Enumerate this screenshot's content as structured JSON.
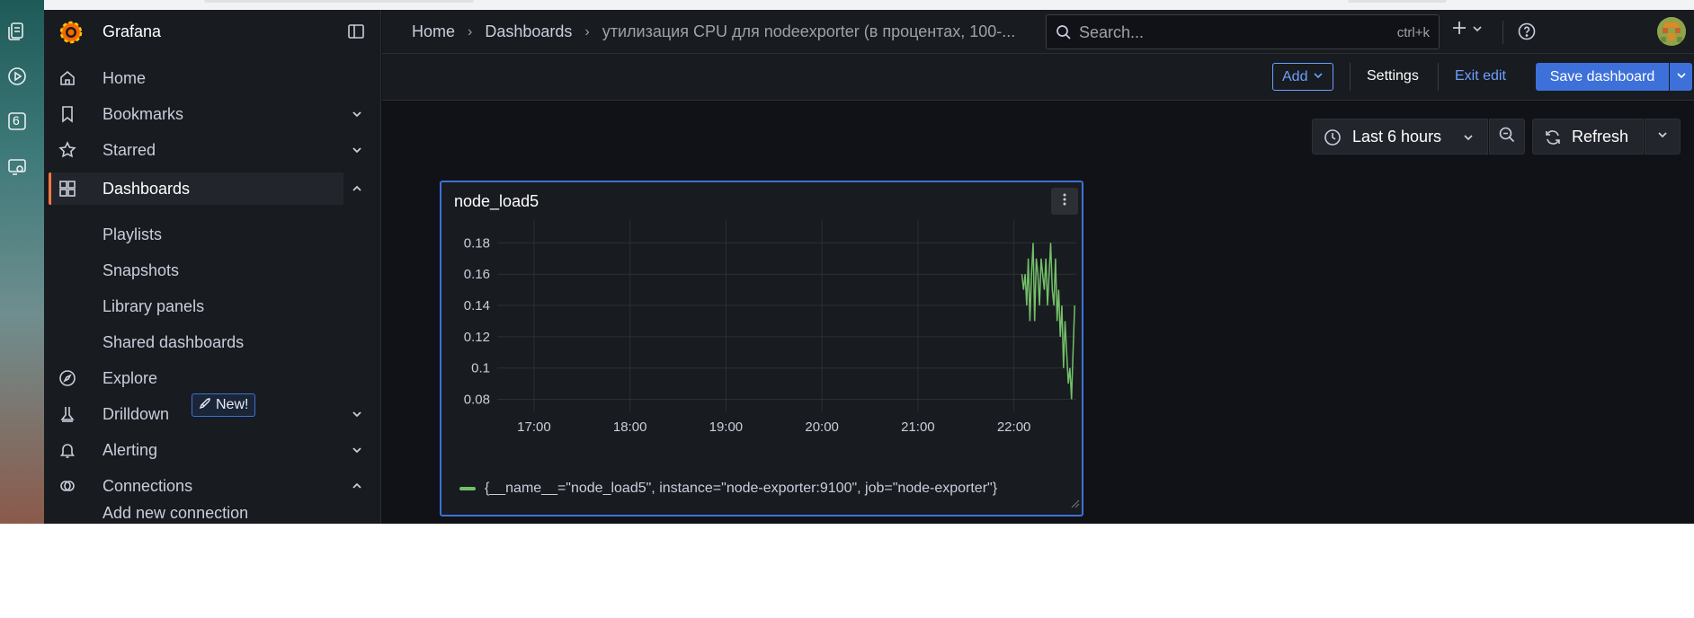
{
  "os_dock": {
    "icons": [
      "documents-icon",
      "play-icon",
      "number-badge-icon",
      "screenshot-icon"
    ],
    "badge_number": "6"
  },
  "brand": {
    "name": "Grafana"
  },
  "sidebar": {
    "items": [
      {
        "label": "Home",
        "icon": "home-icon"
      },
      {
        "label": "Bookmarks",
        "icon": "bookmark-icon",
        "expandable": true
      },
      {
        "label": "Starred",
        "icon": "star-icon",
        "expandable": true
      },
      {
        "label": "Dashboards",
        "icon": "dashboards-icon",
        "expanded": true,
        "active": true
      },
      {
        "label": "Explore",
        "icon": "compass-icon"
      },
      {
        "label": "Drilldown",
        "icon": "drilldown-icon",
        "expandable": true,
        "badge": "New!"
      },
      {
        "label": "Alerting",
        "icon": "bell-icon",
        "expandable": true
      },
      {
        "label": "Connections",
        "icon": "connections-icon",
        "expanded": true
      }
    ],
    "dashboards_children": [
      "Playlists",
      "Snapshots",
      "Library panels",
      "Shared dashboards"
    ],
    "connections_children": [
      "Add new connection"
    ]
  },
  "header": {
    "breadcrumbs": [
      "Home",
      "Dashboards",
      "утилизация CPU для nodeexporter (в процентах, 100-..."
    ],
    "search_placeholder": "Search...",
    "search_shortcut": "ctrl+k"
  },
  "edit_toolbar": {
    "add_label": "Add",
    "settings_label": "Settings",
    "exit_label": "Exit edit",
    "save_label": "Save dashboard"
  },
  "time_controls": {
    "range_label": "Last 6 hours",
    "refresh_label": "Refresh"
  },
  "panel": {
    "title": "node_load5",
    "legend": "{__name__=\"node_load5\", instance=\"node-exporter:9100\", job=\"node-exporter\"}",
    "series_color": "#73bf69"
  },
  "chart_data": {
    "type": "line",
    "title": "node_load5",
    "xlabel": "",
    "ylabel": "",
    "x_ticks": [
      "17:00",
      "18:00",
      "19:00",
      "20:00",
      "21:00",
      "22:00"
    ],
    "y_ticks": [
      0.18,
      0.16,
      0.14,
      0.12,
      0.1,
      0.08
    ],
    "y_tick_labels": [
      "0.18",
      "0.16",
      "0.14",
      "0.12",
      "0.1",
      "0.08"
    ],
    "ylim": [
      0.078,
      0.19
    ],
    "xlim": [
      "16:37",
      "22:39"
    ],
    "grid": true,
    "legend_position": "bottom-left",
    "series": [
      {
        "name": "{__name__=\"node_load5\", instance=\"node-exporter:9100\", job=\"node-exporter\"}",
        "color": "#73bf69",
        "x": [
          "22:05",
          "22:06",
          "22:07",
          "22:08",
          "22:09",
          "22:10",
          "22:11",
          "22:12",
          "22:13",
          "22:14",
          "22:15",
          "22:16",
          "22:17",
          "22:18",
          "22:19",
          "22:20",
          "22:21",
          "22:22",
          "22:23",
          "22:24",
          "22:25",
          "22:26",
          "22:27",
          "22:28",
          "22:29",
          "22:30",
          "22:31",
          "22:32",
          "22:33",
          "22:34",
          "22:35",
          "22:36",
          "22:37",
          "22:38"
        ],
        "values": [
          0.16,
          0.15,
          0.16,
          0.14,
          0.17,
          0.13,
          0.16,
          0.18,
          0.13,
          0.17,
          0.16,
          0.14,
          0.17,
          0.16,
          0.15,
          0.17,
          0.14,
          0.16,
          0.18,
          0.15,
          0.14,
          0.17,
          0.13,
          0.15,
          0.12,
          0.14,
          0.1,
          0.13,
          0.11,
          0.09,
          0.1,
          0.08,
          0.11,
          0.14
        ]
      }
    ]
  }
}
